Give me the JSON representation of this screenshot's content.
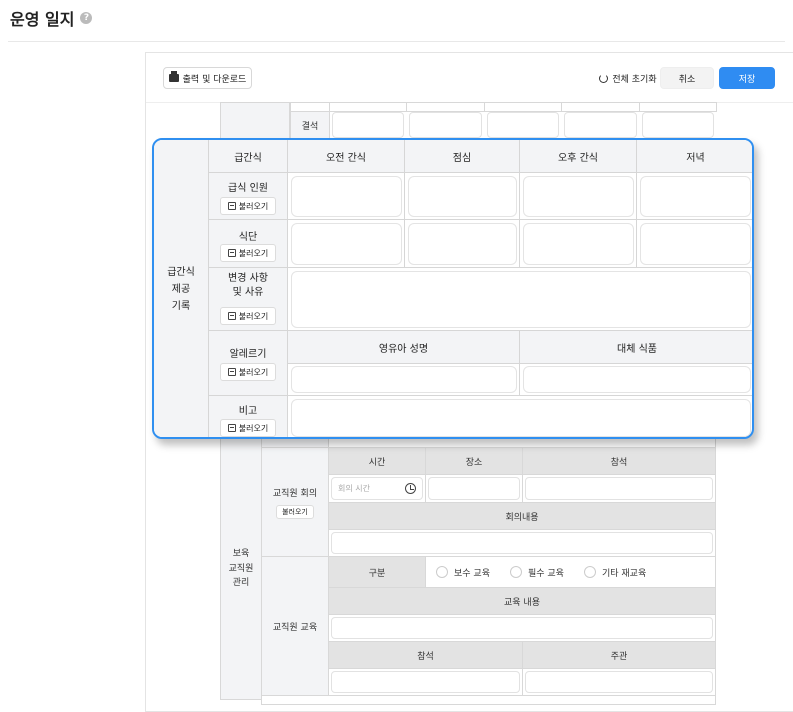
{
  "page": {
    "title": "운영 일지",
    "help_icon": "?"
  },
  "toolbar": {
    "print_label": "출력 및 다운로드",
    "reset_label": "전체 초기화",
    "cancel_label": "취소",
    "save_label": "저장",
    "accent": "#2f8cf2"
  },
  "attendance": {
    "absent_label": "결석"
  },
  "meal": {
    "section_label": "급간식\n제공\n기록",
    "header_label": "급간식",
    "columns": [
      "오전 간식",
      "점심",
      "오후 간식",
      "저녁"
    ],
    "rows": {
      "count": "급식 인원",
      "menu": "식단",
      "changes": "변경 사항\n및 사유",
      "allergy": "알레르기",
      "note": "비고"
    },
    "allergy_columns": [
      "영유아 성명",
      "대체 식품"
    ],
    "load_label": "불러오기"
  },
  "staff": {
    "section_label": "보육\n교직원\n관리",
    "meeting": {
      "label": "교직원 회의",
      "load_label": "불러오기",
      "headers": [
        "시간",
        "장소",
        "참석"
      ],
      "time_placeholder": "회의 시간",
      "content_label": "회의내용"
    },
    "training": {
      "label": "교직원 교육",
      "type_label": "구분",
      "options": [
        "보수 교육",
        "필수 교육",
        "기타 재교육"
      ],
      "content_label": "교육 내용",
      "attend_label": "참석",
      "host_label": "주관"
    }
  }
}
